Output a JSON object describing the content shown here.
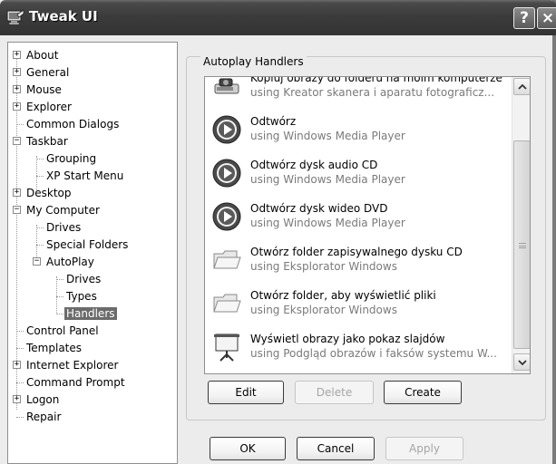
{
  "window": {
    "title": "Tweak UI",
    "help_label": "?",
    "close_label": "×"
  },
  "tree": {
    "items": [
      {
        "label": "About",
        "expander": "+"
      },
      {
        "label": "General",
        "expander": "+"
      },
      {
        "label": "Mouse",
        "expander": "+"
      },
      {
        "label": "Explorer",
        "expander": "+"
      },
      {
        "label": "Common Dialogs",
        "expander": ""
      },
      {
        "label": "Taskbar",
        "expander": "−"
      },
      {
        "label": "Grouping",
        "expander": ""
      },
      {
        "label": "XP Start Menu",
        "expander": ""
      },
      {
        "label": "Desktop",
        "expander": "+"
      },
      {
        "label": "My Computer",
        "expander": "−"
      },
      {
        "label": "Drives",
        "expander": ""
      },
      {
        "label": "Special Folders",
        "expander": ""
      },
      {
        "label": "AutoPlay",
        "expander": "−"
      },
      {
        "label": "Drives",
        "expander": ""
      },
      {
        "label": "Types",
        "expander": ""
      },
      {
        "label": "Handlers",
        "expander": "",
        "selected": true
      },
      {
        "label": "Control Panel",
        "expander": ""
      },
      {
        "label": "Templates",
        "expander": ""
      },
      {
        "label": "Internet Explorer",
        "expander": "+"
      },
      {
        "label": "Command Prompt",
        "expander": ""
      },
      {
        "label": "Logon",
        "expander": "+"
      },
      {
        "label": "Repair",
        "expander": ""
      }
    ]
  },
  "autoplay": {
    "group_label": "Autoplay Handlers",
    "handlers": [
      {
        "name": "Kopiuj obrazy do folderu na moim komputerze",
        "via": "using Kreator skanera i aparatu fotograficz...",
        "icon": "scanner-camera-icon"
      },
      {
        "name": "Odtwórz",
        "via": "using Windows Media Player",
        "icon": "media-play-icon"
      },
      {
        "name": "Odtwórz dysk audio CD",
        "via": "using Windows Media Player",
        "icon": "media-play-icon"
      },
      {
        "name": "Odtwórz dysk wideo DVD",
        "via": "using Windows Media Player",
        "icon": "media-play-icon"
      },
      {
        "name": "Otwórz folder zapisywalnego dysku CD",
        "via": "using Eksplorator Windows",
        "icon": "folder-icon"
      },
      {
        "name": "Otwórz folder, aby wyświetlić pliki",
        "via": "using Eksplorator Windows",
        "icon": "folder-icon"
      },
      {
        "name": "Wyświetl obrazy jako pokaz slajdów",
        "via": "using Podgląd obrazów i faksów systemu W...",
        "icon": "slideshow-projector-icon"
      }
    ],
    "edit_label": "Edit",
    "delete_label": "Delete",
    "create_label": "Create"
  },
  "dialog": {
    "ok_label": "OK",
    "cancel_label": "Cancel",
    "apply_label": "Apply"
  }
}
